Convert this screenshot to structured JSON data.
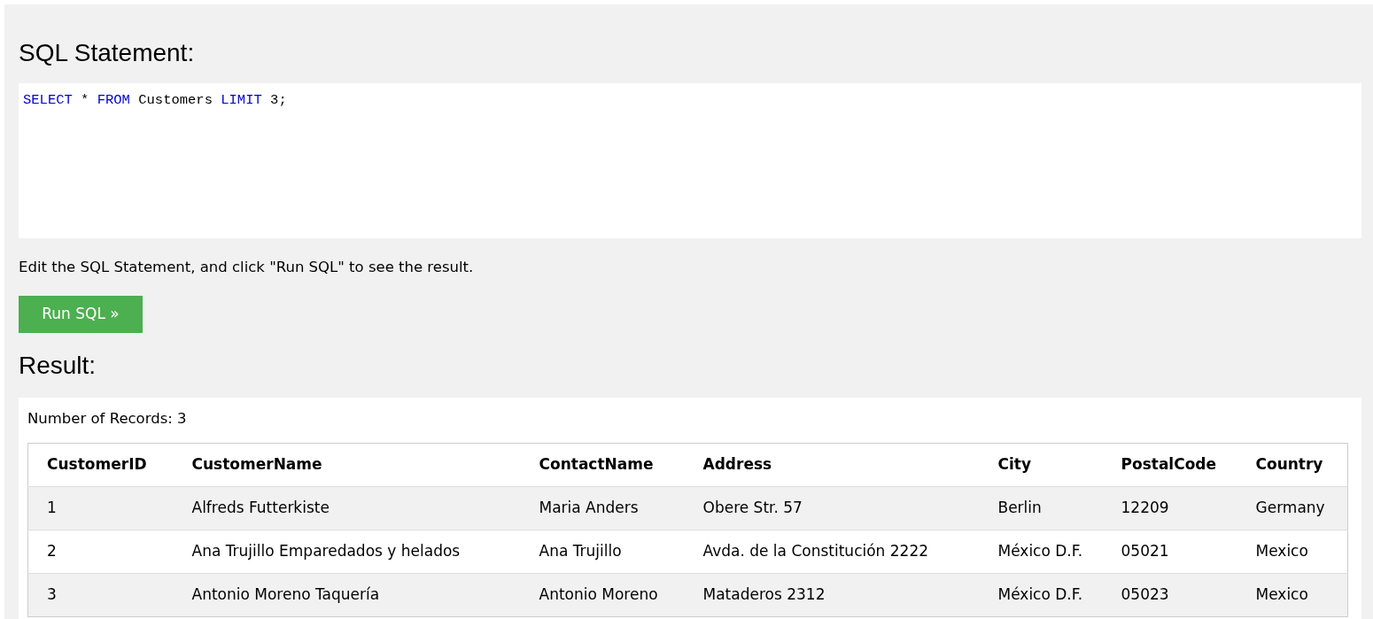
{
  "editor_title": "SQL Statement:",
  "sql_tokens": [
    {
      "text": "SELECT",
      "kind": "keyword"
    },
    {
      "text": " * ",
      "kind": "plain"
    },
    {
      "text": "FROM",
      "kind": "keyword"
    },
    {
      "text": " Customers ",
      "kind": "plain"
    },
    {
      "text": "LIMIT",
      "kind": "keyword"
    },
    {
      "text": " 3;",
      "kind": "plain"
    }
  ],
  "hint": "Edit the SQL Statement, and click \"Run SQL\" to see the result.",
  "run_button": "Run SQL »",
  "result_title": "Result:",
  "record_count": "Number of Records: 3",
  "table": {
    "columns": [
      "CustomerID",
      "CustomerName",
      "ContactName",
      "Address",
      "City",
      "PostalCode",
      "Country"
    ],
    "rows": [
      [
        "1",
        "Alfreds Futterkiste",
        "Maria Anders",
        "Obere Str. 57",
        "Berlin",
        "12209",
        "Germany"
      ],
      [
        "2",
        "Ana Trujillo Emparedados y helados",
        "Ana Trujillo",
        "Avda. de la Constitución 2222",
        "México D.F.",
        "05021",
        "Mexico"
      ],
      [
        "3",
        "Antonio Moreno Taquería",
        "Antonio Moreno",
        "Mataderos 2312",
        "México D.F.",
        "05023",
        "Mexico"
      ]
    ]
  }
}
